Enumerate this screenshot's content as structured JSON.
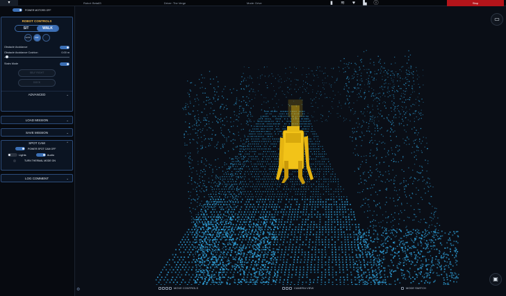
{
  "topbar": {
    "menu_icon": "caret-down-icon",
    "robot": "Robot: Beta83",
    "driver": "Driver: The Verge",
    "mode": "Mode: Drive",
    "stop_label": "Stop",
    "icons": [
      "battery-icon",
      "wifi-icon",
      "shield-heart-icon",
      "boot-icon",
      "info-icon"
    ]
  },
  "sidebar": {
    "power_motors_label": "POWER MOTORS OFF",
    "robot_controls": {
      "title": "ROBOT CONTROLS",
      "sit_label": "SIT",
      "walk_label": "WALK",
      "speeds": [
        "SLOW",
        "NAV",
        ""
      ],
      "obstacle_avoidance_label": "Obstacle Avoidance",
      "cushion_label": "Obstacle Avoidance Cushion",
      "cushion_value": "0.00 m",
      "stairs_label": "Stairs Mode",
      "self_right_label": "SELF RIGHT",
      "dock_label": "DOCK",
      "advanced_label": "ADVANCED"
    },
    "load_mission_label": "LOAD MISSION",
    "save_mission_label": "SAVE MISSION",
    "spot_cam": {
      "title": "SPOT CAM",
      "power_label": "POWER SPOT CAM OFF",
      "lights_label": "Lights",
      "audio_label": "Audio",
      "thermal_label": "TURN THERMAL MODE ON"
    },
    "log_comment_label": "LOG COMMENT"
  },
  "bottombar": {
    "move_controls": "MOVE CONTROLS",
    "camera_view": "CAMERA VIEW",
    "mode_switch": "MODE SWITCH"
  },
  "colors": {
    "accent": "#3d70b8",
    "title": "#f0b648",
    "stop": "#b3141a",
    "points": "#2f9fd8",
    "robot": "#f2c318"
  }
}
